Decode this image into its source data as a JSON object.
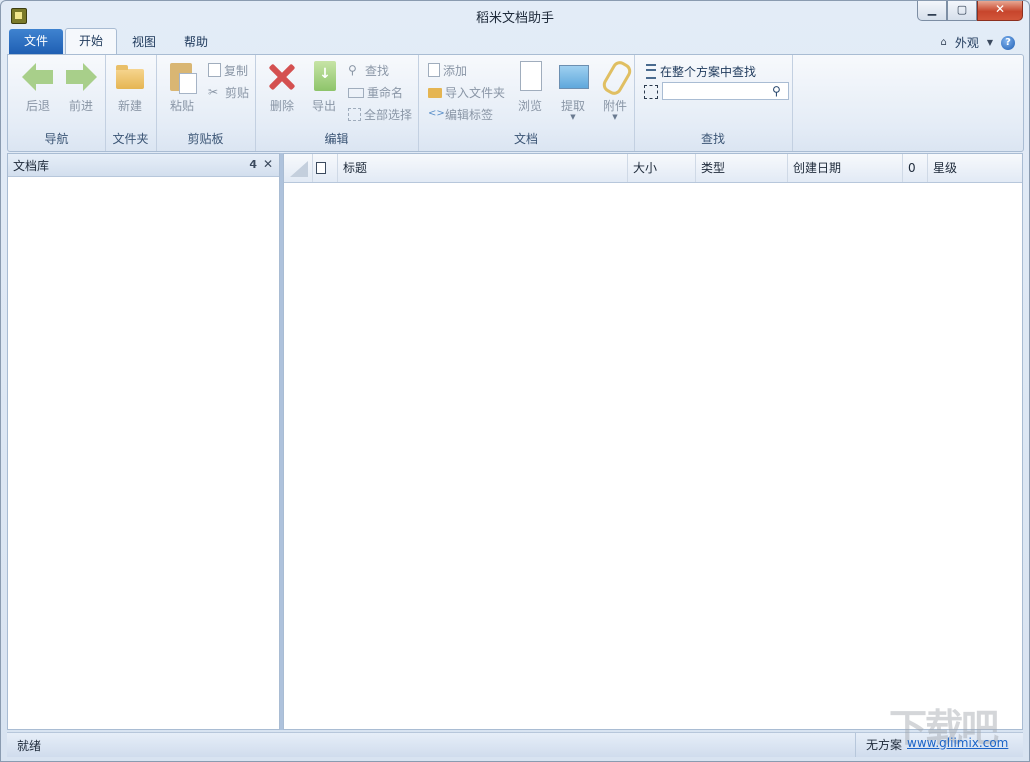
{
  "window": {
    "title": "稻米文档助手"
  },
  "tabs": {
    "file": "文件",
    "items": [
      "开始",
      "视图",
      "帮助"
    ],
    "active": "开始",
    "appearance": "外观"
  },
  "ribbon": {
    "nav": {
      "label": "导航",
      "back": "后退",
      "forward": "前进"
    },
    "folder": {
      "label": "文件夹",
      "new": "新建"
    },
    "clipboard": {
      "label": "剪贴板",
      "paste": "粘贴",
      "copy": "复制",
      "cut": "剪贴"
    },
    "edit": {
      "label": "编辑",
      "delete": "删除",
      "export": "导出",
      "find": "查找",
      "rename": "重命名",
      "select_all": "全部选择"
    },
    "document": {
      "label": "文档",
      "add": "添加",
      "import_folder": "导入文件夹",
      "edit_tags": "编辑标签",
      "browse": "浏览",
      "extract": "提取",
      "attach": "附件"
    },
    "search": {
      "label": "查找",
      "scope": "在整个方案中查找",
      "value": ""
    }
  },
  "left_panel": {
    "title": "文档库"
  },
  "doc_list": {
    "columns": [
      "标题",
      "大小",
      "类型",
      "创建日期",
      "0",
      "星级"
    ]
  },
  "status": {
    "text": "就绪",
    "scheme": "无方案",
    "link": "www.gliimix.com",
    "watermark": "下载吧"
  },
  "colors": {
    "file_tab": "#1f5fb3",
    "accent": "#1e395b",
    "close": "#c7452c"
  }
}
